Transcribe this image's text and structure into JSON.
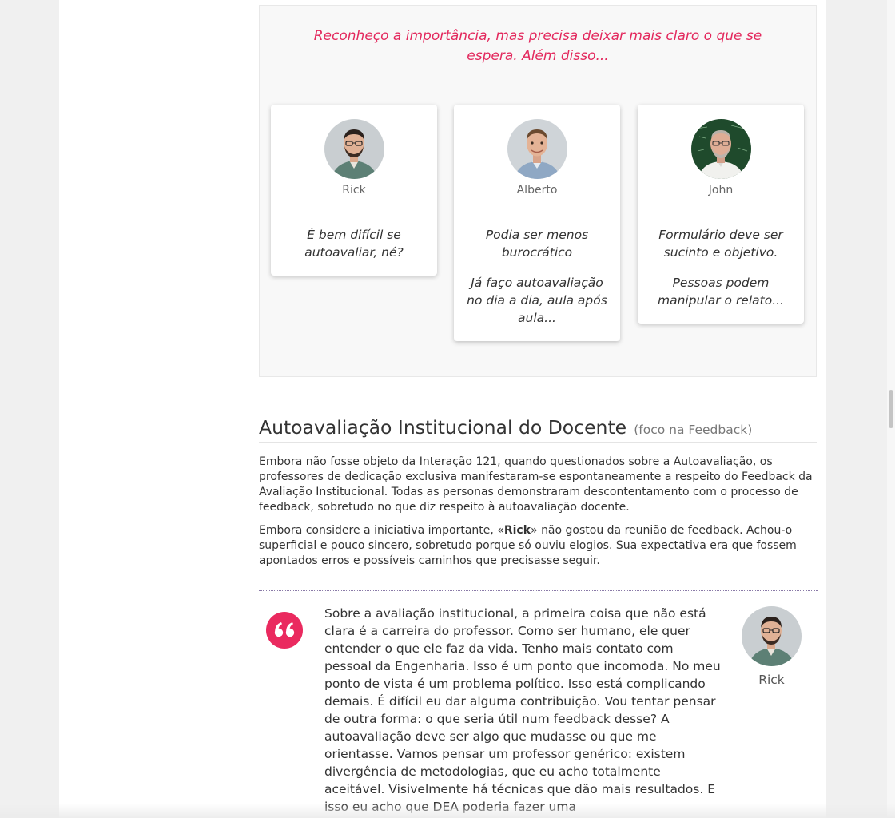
{
  "feedback_panel": {
    "intro": "Reconheço a importância, mas precisa deixar mais claro o que se espera. Além disso...",
    "cards": [
      {
        "name": "Rick",
        "avatar_icon": "rick-avatar-photo",
        "lines": [
          "É bem difícil se autoavaliar, né?"
        ]
      },
      {
        "name": "Alberto",
        "avatar_icon": "alberto-avatar-photo",
        "lines": [
          "Podia ser menos burocrático",
          "Já faço autoavaliação no dia a dia, aula após aula..."
        ]
      },
      {
        "name": "John",
        "avatar_icon": "john-avatar-photo",
        "lines": [
          "Formulário deve ser sucinto e objetivo.",
          "Pessoas podem manipular o relato..."
        ]
      }
    ]
  },
  "section": {
    "title": "Autoavaliação Institucional do Docente",
    "focus": "(foco na Feedback)",
    "paragraph1": "Embora não fosse objeto da Interação 121, quando questionados sobre a Autoavaliação, os professores de dedicação exclusiva manifestaram-se espontaneamente a respeito do Feedback da Avaliação Institucional. Todas as personas demonstraram descontentamento com o processo de feedback, sobretudo no que diz respeito à autoavaliação docente.",
    "paragraph2_before": "Embora considere a iniciativa importante, «",
    "paragraph2_name": "Rick",
    "paragraph2_after": "» não gostou da reunião de feedback. Achou-o superficial e pouco sincero, sobretudo porque só ouviu elogios. Sua expectativa era que fossem apontados erros e possíveis caminhos que precisasse seguir."
  },
  "quote": {
    "icon": "quote-icon",
    "text": "Sobre a avaliação institucional, a primeira coisa que não está clara é a carreira do professor. Como ser humano, ele quer entender o que ele faz da vida. Tenho mais contato com pessoal da Engenharia. Isso é um ponto que incomoda. No meu ponto de vista é um problema político. Isso está complicando demais. É difícil eu dar alguma contribuição. Vou tentar pensar de outra forma: o que seria útil num feedback desse? A autoavaliação deve ser algo que mudasse ou que me orientasse. Vamos pensar um professor genérico: existem divergência de metodologias, que eu acho totalmente aceitável. Visivelmente há técnicas que dão mais resultados. E isso eu acho que DEA poderia fazer uma",
    "author": "Rick",
    "avatar_icon": "rick-avatar-photo"
  },
  "colors": {
    "accent": "#e3285d",
    "quote_badge": "#ea2a5f",
    "panel_bg": "#f8f8f8"
  }
}
